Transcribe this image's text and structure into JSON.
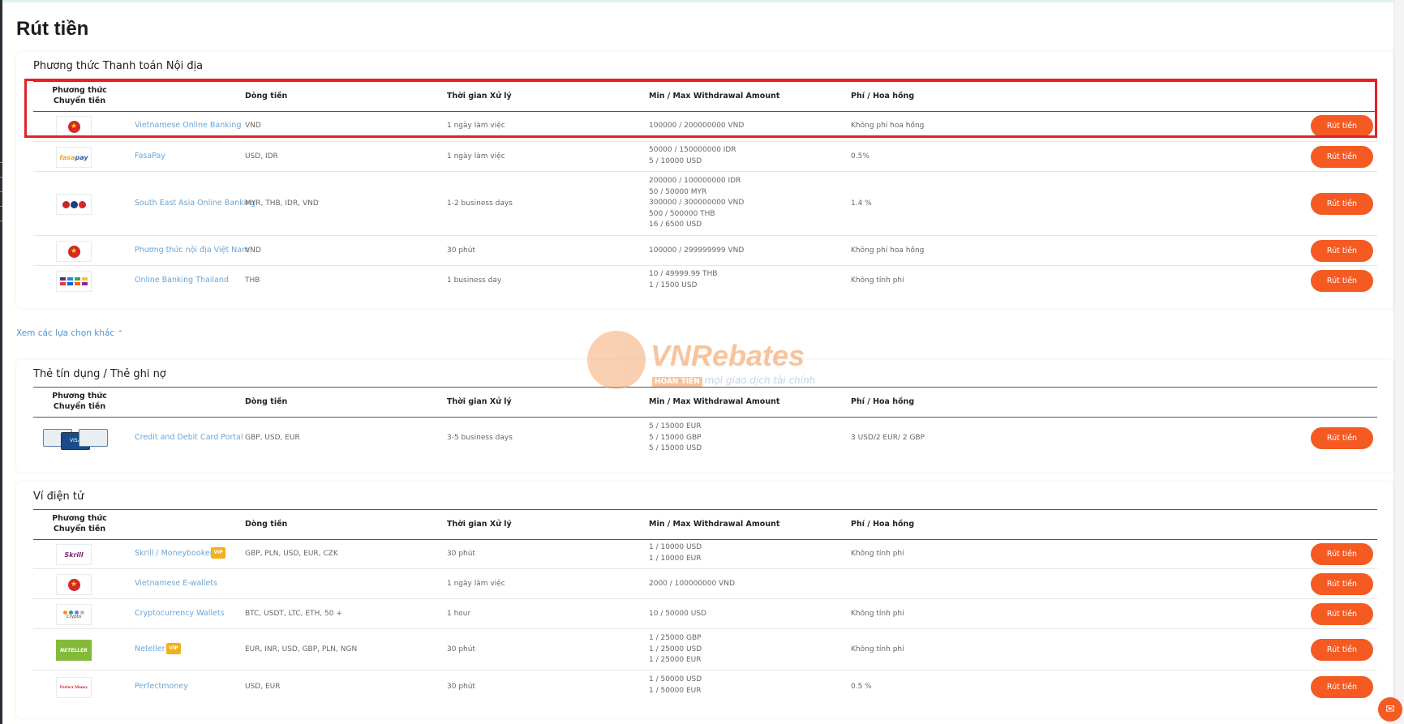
{
  "page": {
    "title": "Rút tiền"
  },
  "headers": {
    "method": "Phương thức Chuyển tiền",
    "currency": "Dòng tiền",
    "time": "Thời gian Xử lý",
    "amount": "Min / Max Withdrawal Amount",
    "fee": "Phí / Hoa hồng"
  },
  "button_label": "Rút tiền",
  "vip_label": "VIP",
  "domestic": {
    "title": "Phương thức Thanh toán Nội địa",
    "rows": [
      {
        "logo": "vietnam-flag",
        "name": "Vietnamese Online Banking",
        "currency": "VND",
        "time": "1 ngày làm việc",
        "amount": [
          "100000 / 200000000 VND"
        ],
        "fee": "Không phí hoa hồng"
      },
      {
        "logo": "fasapay-logo",
        "name": "FasaPay",
        "currency": "USD, IDR",
        "time": "1 ngày làm việc",
        "amount": [
          "50000 / 150000000 IDR",
          "5 / 10000 USD"
        ],
        "fee": "0.5%"
      },
      {
        "logo": "sea-banking-logo",
        "name": "South East Asia Online Banking",
        "currency": "MYR, THB, IDR, VND",
        "time": "1-2 business days",
        "amount": [
          "200000 / 100000000 IDR",
          "50 / 50000 MYR",
          "300000 / 300000000 VND",
          "500 / 500000 THB",
          "16 / 6500 USD"
        ],
        "fee": "1.4 %"
      },
      {
        "logo": "vietnam-flag",
        "name": "Phương thức nội địa Việt Nam",
        "currency": "VND",
        "time": "30 phút",
        "amount": [
          "100000 / 299999999 VND"
        ],
        "fee": "Không phí hoa hồng"
      },
      {
        "logo": "thai-banks-logo",
        "name": "Online Banking Thailand",
        "currency": "THB",
        "time": "1 business day",
        "amount": [
          "10 / 49999.99 THB",
          "1 / 1500 USD"
        ],
        "fee": "Không tính phí"
      }
    ]
  },
  "see_more": "Xem các lựa chọn khác",
  "cards": {
    "title": "Thẻ tín dụng / Thẻ ghi nợ",
    "rows": [
      {
        "logo": "credit-cards-logo",
        "name": "Credit and Debit Card Portal",
        "currency": "GBP, USD, EUR",
        "time": "3-5 business days",
        "amount": [
          "5 / 15000 EUR",
          "5 / 15000 GBP",
          "5 / 15000 USD"
        ],
        "fee": "3 USD/2 EUR/ 2 GBP"
      }
    ]
  },
  "ewallets": {
    "title": "Ví điện tử",
    "rows": [
      {
        "logo": "skrill-logo",
        "logo_text": "Skrill",
        "name": "Skrill / Moneybookers",
        "vip": true,
        "currency": "GBP, PLN, USD, EUR, CZK",
        "time": "30 phút",
        "amount": [
          "1 / 10000 USD",
          "1 / 10000 EUR"
        ],
        "fee": "Không tính phí"
      },
      {
        "logo": "vietnam-flag",
        "name": "Vietnamese E-wallets",
        "currency": "",
        "time": "1 ngày làm việc",
        "amount": [
          "2000 / 100000000 VND"
        ],
        "fee": ""
      },
      {
        "logo": "crypto-logo",
        "logo_text": "Crypto",
        "name": "Cryptocurrency Wallets",
        "currency": "BTC, USDT, LTC, ETH, 50 +",
        "time": "1 hour",
        "amount": [
          "10 / 50000 USD"
        ],
        "fee": "Không tính phí"
      },
      {
        "logo": "neteller-logo",
        "logo_text": "NETELLER",
        "name": "Neteller",
        "vip": true,
        "currency": "EUR, INR, USD, GBP, PLN, NGN",
        "time": "30 phút",
        "amount": [
          "1 / 25000 GBP",
          "1 / 25000 USD",
          "1 / 25000 EUR"
        ],
        "fee": "Không tính phí"
      },
      {
        "logo": "perfectmoney-logo",
        "logo_text": "Perfect Money",
        "name": "Perfectmoney",
        "currency": "USD, EUR",
        "time": "30 phút",
        "amount": [
          "1 / 50000 USD",
          "1 / 50000 EUR"
        ],
        "fee": "0.5 %"
      }
    ]
  },
  "watermark": {
    "brand": "VNRebates",
    "tag": "HOÀN TIỀN",
    "sub": "mọi giao dịch tài chính"
  }
}
